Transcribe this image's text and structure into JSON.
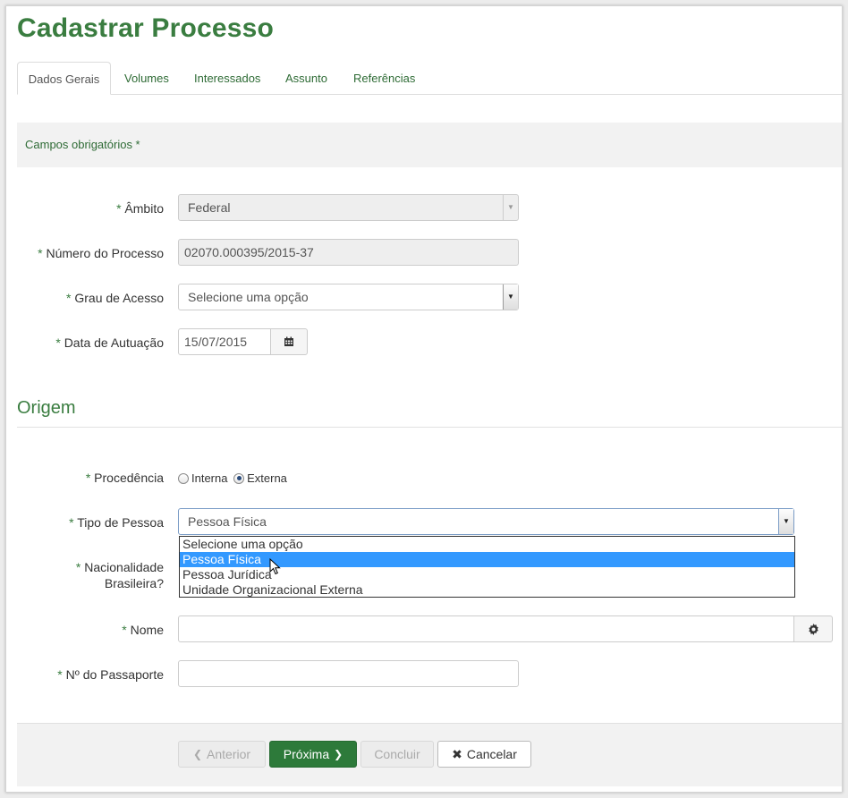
{
  "page": {
    "title": "Cadastrar Processo"
  },
  "tabs": [
    {
      "label": "Dados Gerais",
      "active": true
    },
    {
      "label": "Volumes"
    },
    {
      "label": "Interessados"
    },
    {
      "label": "Assunto"
    },
    {
      "label": "Referências"
    }
  ],
  "required_note": "Campos obrigatórios *",
  "required_marker": "*",
  "form": {
    "ambito": {
      "label": "Âmbito",
      "value": "Federal"
    },
    "numero": {
      "label": "Número do Processo",
      "value": "02070.000395/2015-37"
    },
    "grau": {
      "label": "Grau de Acesso",
      "value": "Selecione uma opção"
    },
    "data": {
      "label": "Data de Autuação",
      "value": "15/07/2015"
    }
  },
  "origem": {
    "title": "Origem",
    "procedencia": {
      "label": "Procedência",
      "options": [
        "Interna",
        "Externa"
      ],
      "selected": "Externa"
    },
    "tipo_pessoa": {
      "label": "Tipo de Pessoa",
      "value": "Pessoa Física",
      "options": [
        "Selecione uma opção",
        "Pessoa Física",
        "Pessoa Jurídica",
        "Unidade Organizacional Externa"
      ],
      "highlighted": "Pessoa Física"
    },
    "nacionalidade": {
      "label_line1": "Nacionalidade",
      "label_line2": "Brasileira?"
    },
    "nome": {
      "label": "Nome",
      "value": ""
    },
    "passaporte": {
      "label": "Nº do Passaporte",
      "value": ""
    }
  },
  "footer": {
    "anterior": "Anterior",
    "proxima": "Próxima",
    "concluir": "Concluir",
    "cancelar": "Cancelar"
  },
  "colors": {
    "brand_green": "#3a7d40",
    "primary_button": "#2d7a3a",
    "highlight": "#3399ff"
  }
}
